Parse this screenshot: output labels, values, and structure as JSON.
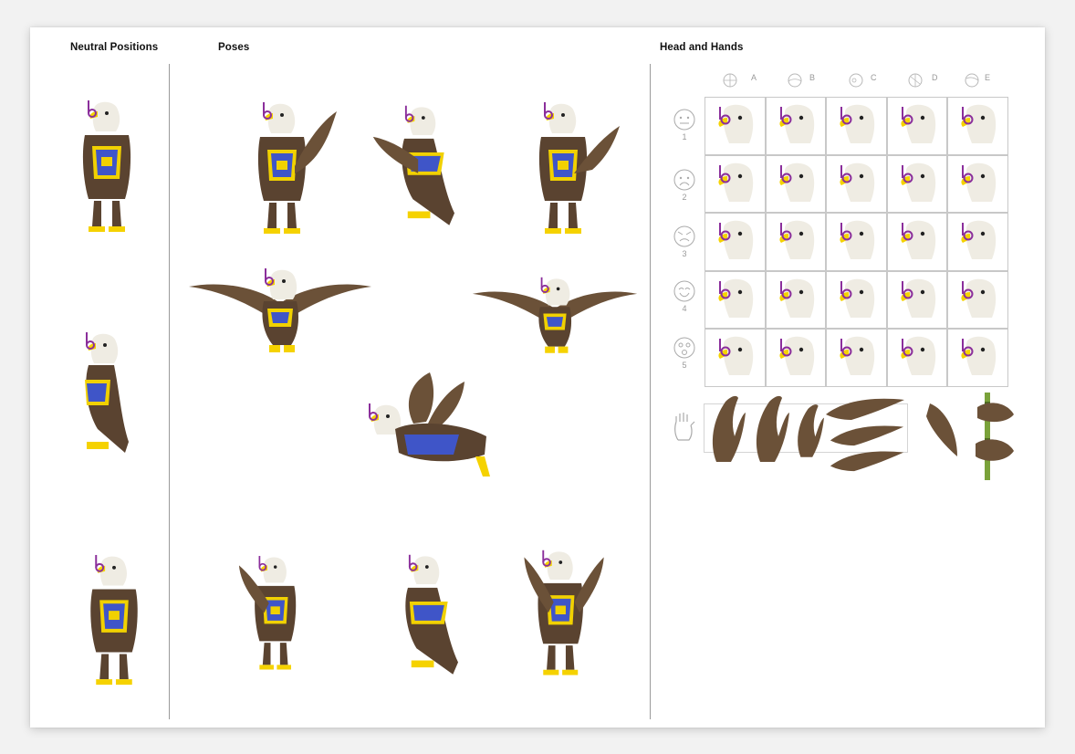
{
  "sections": {
    "neutral": "Neutral Positions",
    "poses": "Poses",
    "head_hands": "Head and Hands"
  },
  "head_grid": {
    "columns": [
      "A",
      "B",
      "C",
      "D",
      "E"
    ],
    "rows": [
      "1",
      "2",
      "3",
      "4",
      "5"
    ]
  },
  "colors": {
    "wing_brown": "#6b5138",
    "body_brown": "#5a4330",
    "head_white": "#efece3",
    "beak_yellow": "#f5d200",
    "vest_blue": "#3f55c8",
    "vest_trim": "#f1d100",
    "glasses_purple": "#8b2f9b",
    "stick_green": "#7aa23a"
  }
}
